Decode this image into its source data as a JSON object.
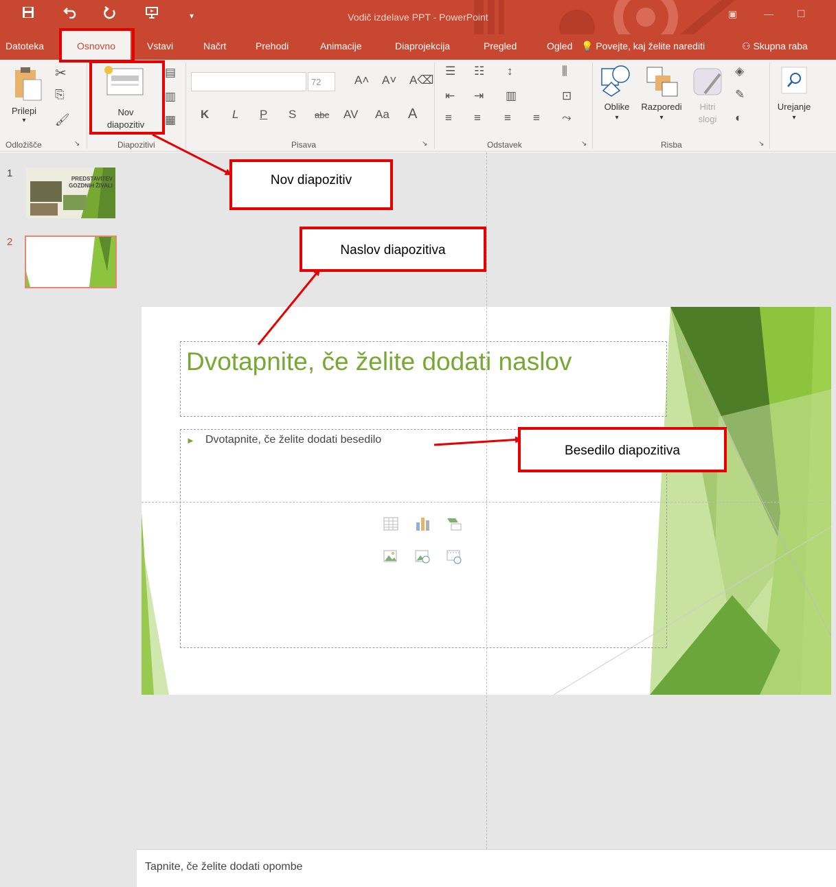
{
  "window": {
    "title": "Vodič izdelave PPT - PowerPoint",
    "quick_access": [
      {
        "icon": "save-icon",
        "glyph": "🖫"
      },
      {
        "icon": "undo-icon",
        "glyph": "↶"
      },
      {
        "icon": "redo-icon",
        "glyph": "↻"
      },
      {
        "icon": "present-icon",
        "glyph": "▣"
      },
      {
        "icon": "customize-icon",
        "glyph": "▾"
      }
    ]
  },
  "tabs": {
    "items": [
      "Datoteka",
      "Osnovno",
      "Vstavi",
      "Načrt",
      "Prehodi",
      "Animacije",
      "Diaprojekcija",
      "Pregled",
      "Ogled"
    ],
    "active": "Osnovno",
    "tell_me": "Povejte, kaj želite narediti",
    "share": "Skupna raba"
  },
  "ribbon": {
    "clipboard": {
      "paste": "Prilepi",
      "group": "Odložišče"
    },
    "slides": {
      "new_slide_line1": "Nov",
      "new_slide_line2": "diapozitiv",
      "group": "Diapozitivi"
    },
    "font": {
      "size": "72",
      "bold": "K",
      "italic": "L",
      "underline": "P",
      "shadow": "S",
      "strike": "abc",
      "spacing": "AV",
      "case": "Aa",
      "color": "A",
      "group": "Pisava"
    },
    "paragraph": {
      "group": "Odstavek"
    },
    "drawing": {
      "shapes": "Oblike",
      "arrange": "Razporedi",
      "quick_styles_line1": "Hitri",
      "quick_styles_line2": "slogi",
      "group": "Risba"
    },
    "editing": {
      "label": "Urejanje"
    }
  },
  "thumbnails": [
    {
      "number": "1",
      "title_line1": "PREDSTAVITEV",
      "title_line2": "GOZDNIH ŽIVALI"
    },
    {
      "number": "2"
    }
  ],
  "slide": {
    "title_placeholder": "Dvotapnite, če želite dodati naslov",
    "body_placeholder": "Dvotapnite, če želite dodati besedilo",
    "bullet": "►"
  },
  "notes": {
    "placeholder": "Tapnite, če želite dodati opombe"
  },
  "annotations": {
    "new_slide": "Nov diapozitiv",
    "slide_title": "Naslov diapozitiva",
    "slide_text": "Besedilo diapozitiva"
  },
  "colors": {
    "accent": "#c74731",
    "annotation": "#e60000",
    "theme_green": "#76a832"
  }
}
